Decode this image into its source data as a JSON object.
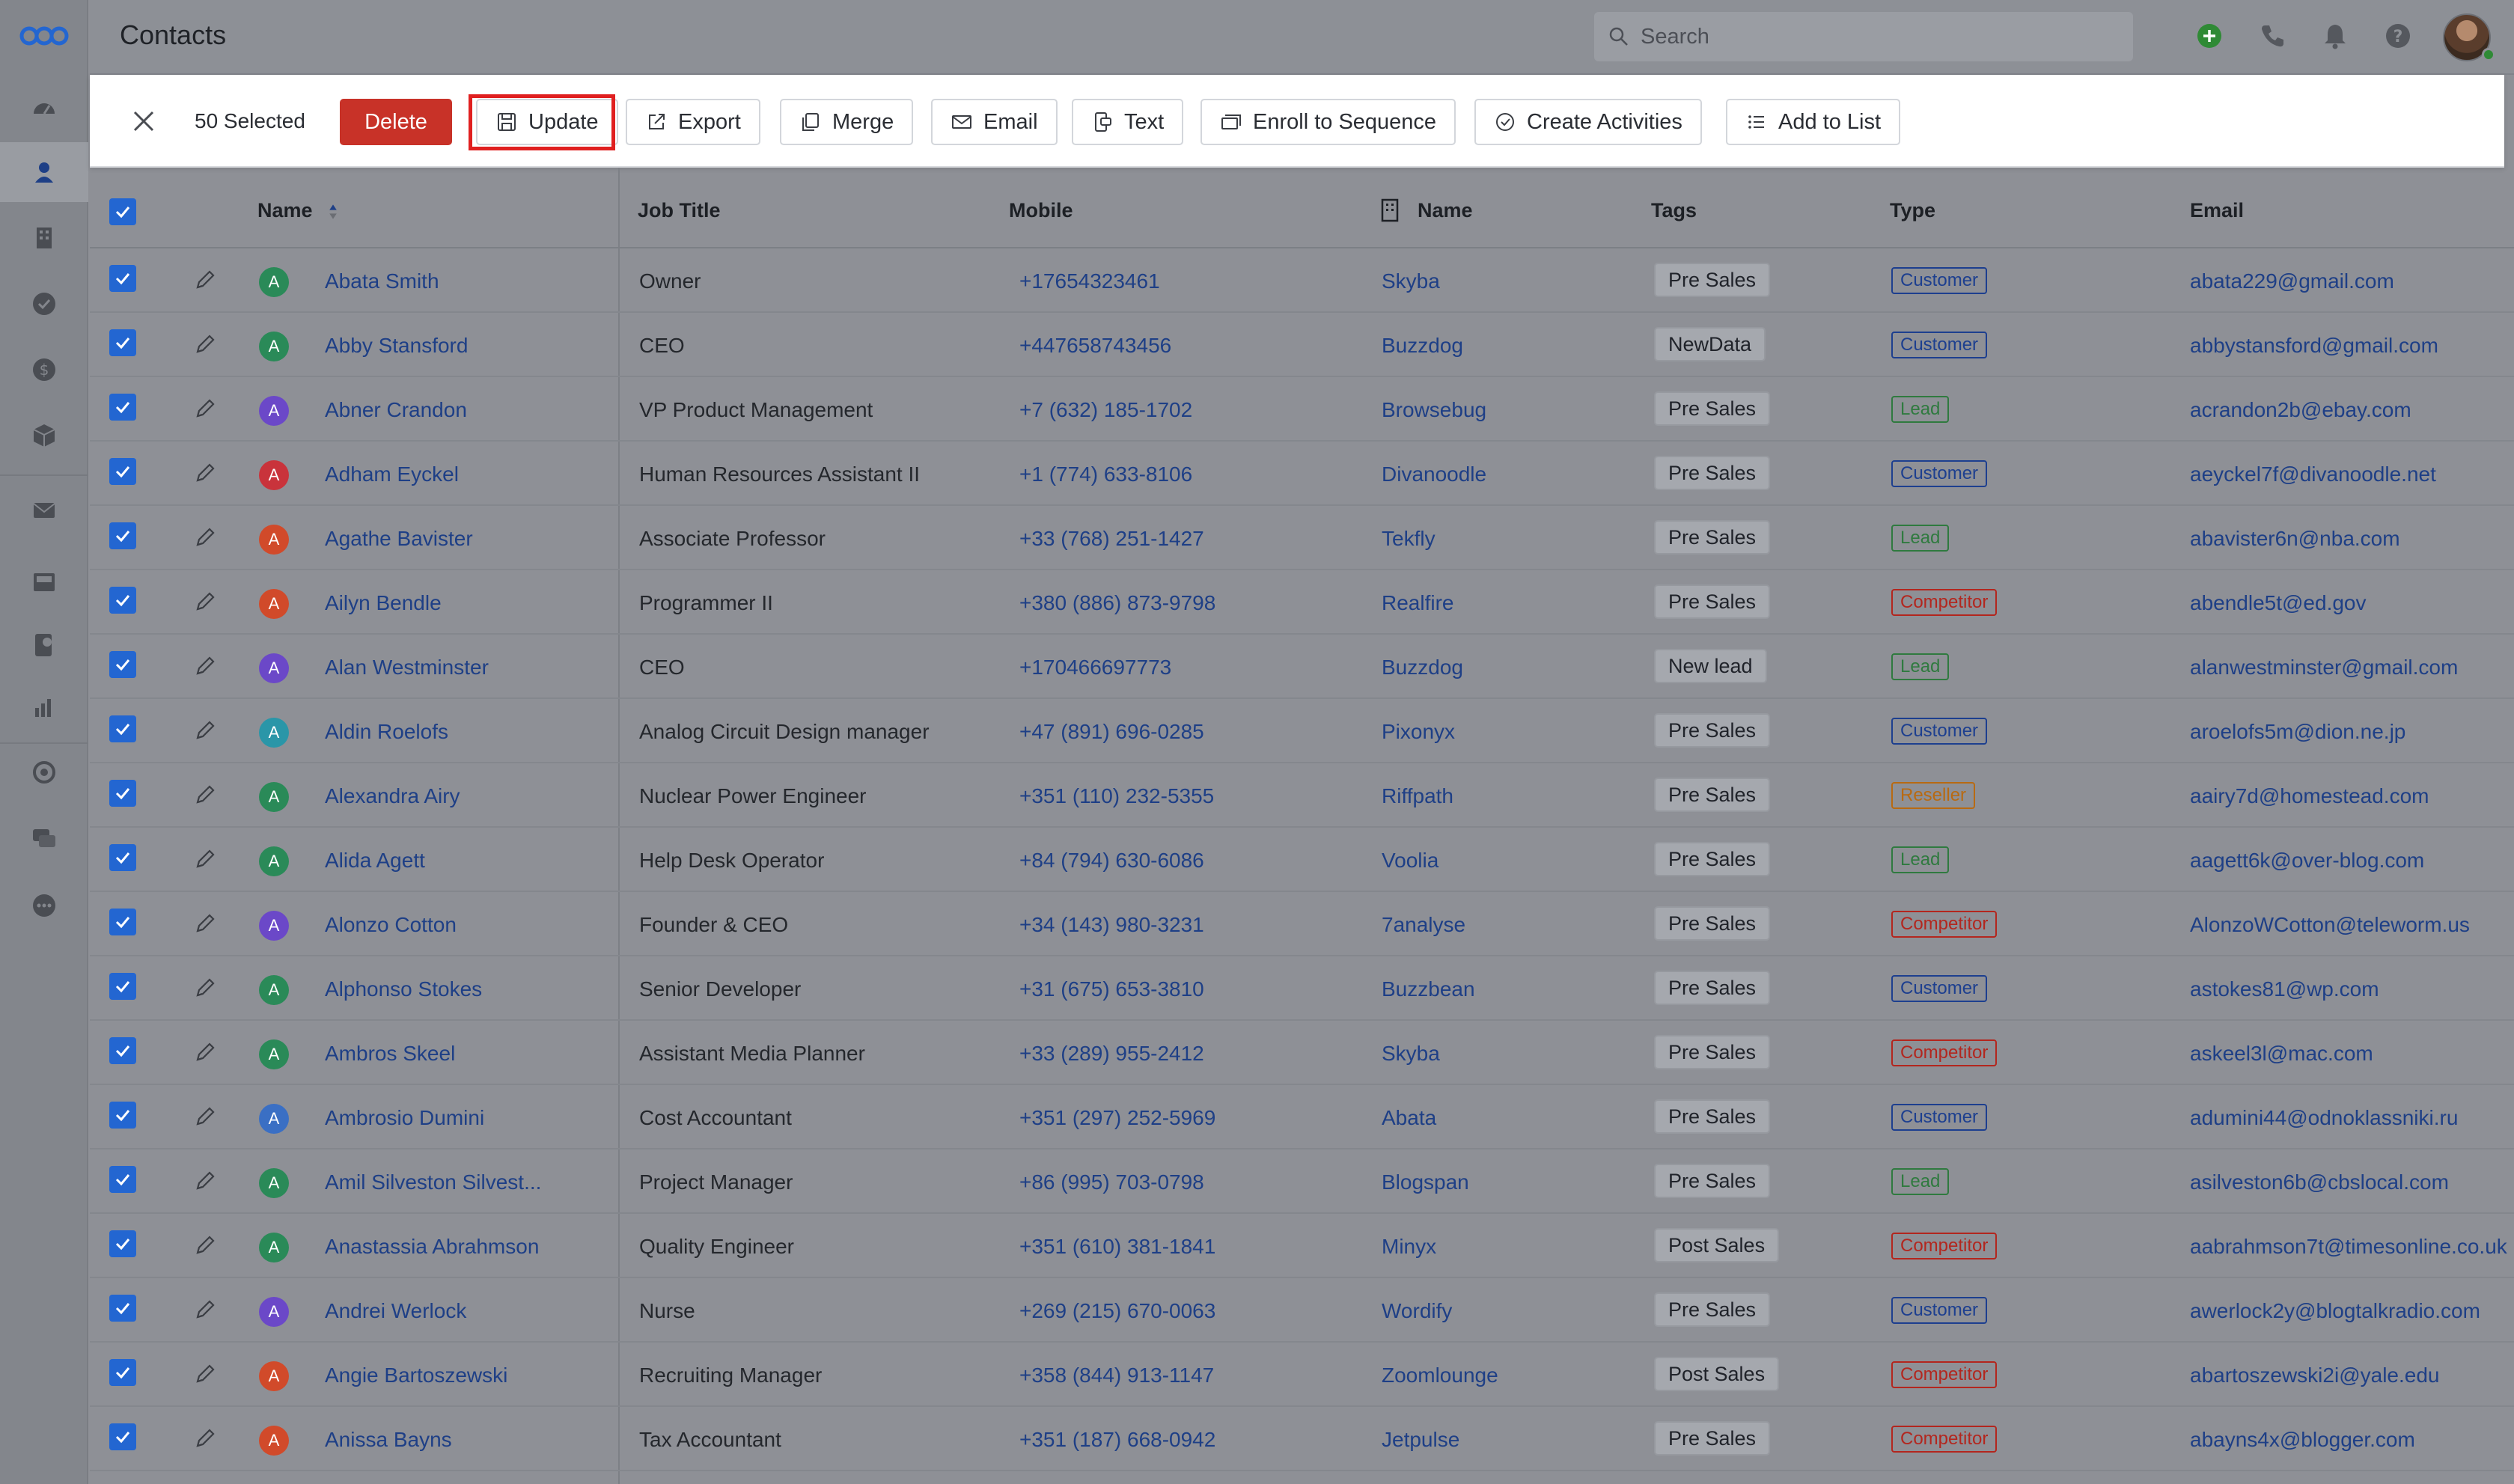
{
  "header": {
    "title": "Contacts",
    "search_placeholder": "Search"
  },
  "action_bar": {
    "selected": "50 Selected",
    "buttons": {
      "delete": "Delete",
      "update": "Update",
      "export": "Export",
      "merge": "Merge",
      "email": "Email",
      "text": "Text",
      "enroll": "Enroll to Sequence",
      "activities": "Create Activities",
      "add_to_list": "Add to List"
    }
  },
  "sidebar": {
    "items": [
      "dashboard-icon",
      "contacts-icon",
      "companies-icon",
      "tasks-icon",
      "deals-icon",
      "products-icon",
      "email-icon",
      "inbox-icon",
      "phone-log-icon",
      "reports-icon",
      "automation-icon",
      "chat-icon",
      "more-icon"
    ],
    "active": "contacts-icon"
  },
  "table": {
    "columns": {
      "name": "Name",
      "job_title": "Job Title",
      "mobile": "Mobile",
      "company": "Name",
      "tags": "Tags",
      "type": "Type",
      "email": "Email"
    },
    "rows": [
      {
        "initial": "A",
        "name": "Abata Smith",
        "job": "Owner",
        "mobile": "+17654323461",
        "company": "Skyba",
        "tag": "Pre Sales",
        "type": "Customer",
        "email": "abata229@gmail.com",
        "avatar_color": "#2a8a58"
      },
      {
        "initial": "A",
        "name": "Abby Stansford",
        "job": "CEO",
        "mobile": "+447658743456",
        "company": "Buzzdog",
        "tag": "NewData",
        "type": "Customer",
        "email": "abbystansford@gmail.com",
        "avatar_color": "#2a8a58"
      },
      {
        "initial": "A",
        "name": "Abner Crandon",
        "job": "VP Product Management",
        "mobile": "+7 (632) 185-1702",
        "company": "Browsebug",
        "tag": "Pre Sales",
        "type": "Lead",
        "email": "acrandon2b@ebay.com",
        "avatar_color": "#6b48c8"
      },
      {
        "initial": "A",
        "name": "Adham Eyckel",
        "job": "Human Resources Assistant II",
        "mobile": "+1 (774) 633-8106",
        "company": "Divanoodle",
        "tag": "Pre Sales",
        "type": "Customer",
        "email": "aeyckel7f@divanoodle.net",
        "avatar_color": "#c9333b"
      },
      {
        "initial": "A",
        "name": "Agathe Bavister",
        "job": "Associate Professor",
        "mobile": "+33 (768) 251-1427",
        "company": "Tekfly",
        "tag": "Pre Sales",
        "type": "Lead",
        "email": "abavister6n@nba.com",
        "avatar_color": "#d14a2a"
      },
      {
        "initial": "A",
        "name": "Ailyn Bendle",
        "job": "Programmer II",
        "mobile": "+380 (886) 873-9798",
        "company": "Realfire",
        "tag": "Pre Sales",
        "type": "Competitor",
        "email": "abendle5t@ed.gov",
        "avatar_color": "#d14a2a"
      },
      {
        "initial": "A",
        "name": "Alan Westminster",
        "job": "CEO",
        "mobile": "+170466697773",
        "company": "Buzzdog",
        "tag": "New lead",
        "type": "Lead",
        "email": "alanwestminster@gmail.com",
        "avatar_color": "#6b48c8"
      },
      {
        "initial": "A",
        "name": "Aldin Roelofs",
        "job": "Analog Circuit Design manager",
        "mobile": "+47 (891) 696-0285",
        "company": "Pixonyx",
        "tag": "Pre Sales",
        "type": "Customer",
        "email": "aroelofs5m@dion.ne.jp",
        "avatar_color": "#2a96a8"
      },
      {
        "initial": "A",
        "name": "Alexandra Airy",
        "job": "Nuclear Power Engineer",
        "mobile": "+351 (110) 232-5355",
        "company": "Riffpath",
        "tag": "Pre Sales",
        "type": "Reseller",
        "email": "aairy7d@homestead.com",
        "avatar_color": "#2a8a58"
      },
      {
        "initial": "A",
        "name": "Alida Agett",
        "job": "Help Desk Operator",
        "mobile": "+84 (794) 630-6086",
        "company": "Voolia",
        "tag": "Pre Sales",
        "type": "Lead",
        "email": "aagett6k@over-blog.com",
        "avatar_color": "#2a8a58"
      },
      {
        "initial": "A",
        "name": "Alonzo Cotton",
        "job": "Founder & CEO",
        "mobile": "+34 (143) 980-3231",
        "company": "7analyse",
        "tag": "Pre Sales",
        "type": "Competitor",
        "email": "AlonzoWCotton@teleworm.us",
        "avatar_color": "#6b48c8"
      },
      {
        "initial": "A",
        "name": "Alphonso Stokes",
        "job": "Senior Developer",
        "mobile": "+31 (675) 653-3810",
        "company": "Buzzbean",
        "tag": "Pre Sales",
        "type": "Customer",
        "email": "astokes81@wp.com",
        "avatar_color": "#2a8a58"
      },
      {
        "initial": "A",
        "name": "Ambros Skeel",
        "job": "Assistant Media Planner",
        "mobile": "+33 (289) 955-2412",
        "company": "Skyba",
        "tag": "Pre Sales",
        "type": "Competitor",
        "email": "askeel3l@mac.com",
        "avatar_color": "#2a8a58"
      },
      {
        "initial": "A",
        "name": "Ambrosio Dumini",
        "job": "Cost Accountant",
        "mobile": "+351 (297) 252-5969",
        "company": "Abata",
        "tag": "Pre Sales",
        "type": "Customer",
        "email": "adumini44@odnoklassniki.ru",
        "avatar_color": "#3a6fc4"
      },
      {
        "initial": "A",
        "name": "Amil Silveston Silvest...",
        "job": "Project Manager",
        "mobile": "+86 (995) 703-0798",
        "company": "Blogspan",
        "tag": "Pre Sales",
        "type": "Lead",
        "email": "asilveston6b@cbslocal.com",
        "avatar_color": "#2a8a58"
      },
      {
        "initial": "A",
        "name": "Anastassia Abrahmson",
        "job": "Quality Engineer",
        "mobile": "+351 (610) 381-1841",
        "company": "Minyx",
        "tag": "Post Sales",
        "type": "Competitor",
        "email": "aabrahmson7t@timesonline.co.uk",
        "avatar_color": "#2a8a58"
      },
      {
        "initial": "A",
        "name": "Andrei Werlock",
        "job": "Nurse",
        "mobile": "+269 (215) 670-0063",
        "company": "Wordify",
        "tag": "Pre Sales",
        "type": "Customer",
        "email": "awerlock2y@blogtalkradio.com",
        "avatar_color": "#6b48c8"
      },
      {
        "initial": "A",
        "name": "Angie Bartoszewski",
        "job": "Recruiting Manager",
        "mobile": "+358 (844) 913-1147",
        "company": "Zoomlounge",
        "tag": "Post Sales",
        "type": "Competitor",
        "email": "abartoszewski2i@yale.edu",
        "avatar_color": "#d14a2a"
      },
      {
        "initial": "A",
        "name": "Anissa Bayns",
        "job": "Tax Accountant",
        "mobile": "+351 (187) 668-0942",
        "company": "Jetpulse",
        "tag": "Pre Sales",
        "type": "Competitor",
        "email": "abayns4x@blogger.com",
        "avatar_color": "#d14a2a"
      }
    ]
  },
  "colors": {
    "accent": "#2366d1",
    "delete": "#c83228",
    "highlight": "#e02020",
    "type_customer": "#1d3f8f",
    "type_lead": "#2f7a3f",
    "type_competitor": "#b3261e",
    "type_reseller": "#b86a12"
  }
}
